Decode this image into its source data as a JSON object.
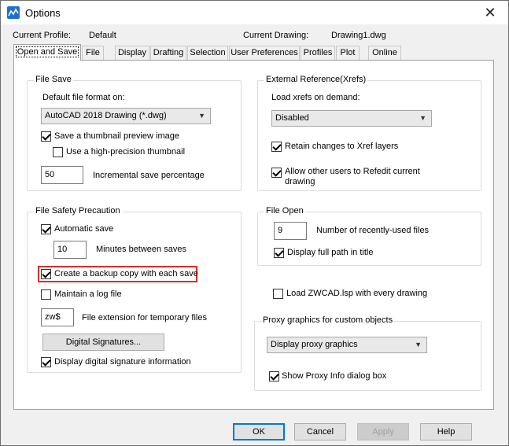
{
  "window": {
    "title": "Options",
    "close_glyph": "✕"
  },
  "header": {
    "profile_label": "Current Profile:",
    "profile_value": "Default",
    "drawing_label": "Current Drawing:",
    "drawing_value": "Drawing1.dwg"
  },
  "tabs": [
    {
      "label": "Open and Save",
      "active": true
    },
    {
      "label": "File"
    },
    {
      "label": "Display"
    },
    {
      "label": "Drafting"
    },
    {
      "label": "Selection"
    },
    {
      "label": "User Preferences"
    },
    {
      "label": "Profiles"
    },
    {
      "label": "Plot"
    },
    {
      "label": "Online"
    }
  ],
  "file_save": {
    "title": "File Save",
    "format_label": "Default file format on:",
    "format_value": "AutoCAD 2018 Drawing (*.dwg)",
    "thumbnail_label": "Save a thumbnail preview image",
    "thumbnail_checked": true,
    "high_precision_label": "Use a high-precision thumbnail",
    "high_precision_checked": false,
    "incremental_value": "50",
    "incremental_label": "Incremental save percentage"
  },
  "file_safety": {
    "title": "File Safety Precaution",
    "autosave_label": "Automatic save",
    "autosave_checked": true,
    "minutes_value": "10",
    "minutes_label": "Minutes between saves",
    "backup_label": "Create a backup copy with each save",
    "backup_checked": true,
    "log_label": "Maintain a log file",
    "log_checked": false,
    "ext_value": "zw$",
    "ext_label": "File extension for temporary files",
    "digital_sig_button": "Digital Signatures...",
    "display_sig_label": "Display digital signature information",
    "display_sig_checked": true
  },
  "xref": {
    "title": "External Reference(Xrefs)",
    "load_label": "Load xrefs on demand:",
    "load_value": "Disabled",
    "retain_label": "Retain changes to Xref layers",
    "retain_checked": true,
    "allow_label_1": "Allow other users to Refedit current",
    "allow_label_2": "drawing",
    "allow_checked": true
  },
  "file_open": {
    "title": "File Open",
    "recent_value": "9",
    "recent_label": "Number of recently-used files",
    "fullpath_label": "Display full path in title",
    "fullpath_checked": true
  },
  "lsp": {
    "label": "Load ZWCAD.lsp with every drawing",
    "checked": false
  },
  "proxy": {
    "title": "Proxy graphics for custom objects",
    "value": "Display proxy graphics",
    "show_info_label": "Show Proxy Info dialog box",
    "show_info_checked": true
  },
  "buttons": {
    "ok": "OK",
    "cancel": "Cancel",
    "apply": "Apply",
    "help": "Help"
  },
  "colors": {
    "highlight": "#e02b2b",
    "default_button_border": "#0078d7"
  }
}
